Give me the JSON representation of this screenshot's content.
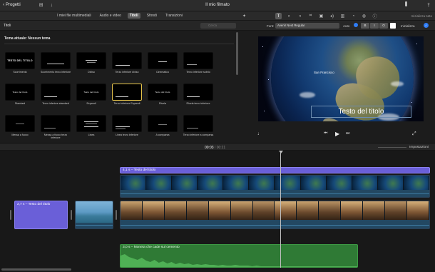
{
  "window": {
    "back_label": "Progetti",
    "title": "Il mio filmato"
  },
  "browser": {
    "tabs": [
      {
        "label": "I miei file multimediali",
        "active": false
      },
      {
        "label": "Audio e video",
        "active": false
      },
      {
        "label": "Titoli",
        "active": true
      },
      {
        "label": "Sfondi",
        "active": false
      },
      {
        "label": "Transizioni",
        "active": false
      }
    ],
    "section_title": "Titoli",
    "search_placeholder": "Cerca",
    "theme_label": "Tema attuale: Nessun tema",
    "titles": [
      {
        "label": "Scorrimento",
        "thumb": ""
      },
      {
        "label": "Scorrimento terzo inferiore",
        "thumb": ""
      },
      {
        "label": "Diviso",
        "thumb": ""
      },
      {
        "label": "Terzo inferiore diviso",
        "thumb": ""
      },
      {
        "label": "Cinematico",
        "thumb": ""
      },
      {
        "label": "Terzo inferiore sobrio",
        "thumb": ""
      },
      {
        "label": "Standard",
        "thumb": "Testo del titolo"
      },
      {
        "label": "Terzo inferiore standard",
        "thumb": ""
      },
      {
        "label": "Espandi",
        "thumb": "Testo del titolo"
      },
      {
        "label": "Terzo inferiore Espandi",
        "thumb": ""
      },
      {
        "label": "Rivela",
        "thumb": "Testo del titolo"
      },
      {
        "label": "Rivela terzo inferiore",
        "thumb": ""
      },
      {
        "label": "Messa a fuoco",
        "thumb": ""
      },
      {
        "label": "Messa a fuoco terzo inferiore",
        "thumb": ""
      },
      {
        "label": "Linea",
        "thumb": ""
      },
      {
        "label": "Linea terzo inferiore",
        "thumb": ""
      },
      {
        "label": "A comparsa",
        "thumb": ""
      },
      {
        "label": "Terzo inferiore a comparsa",
        "thumb": ""
      }
    ],
    "first_thumb_text": "TESTO DEL TITOLO"
  },
  "viewer_tools": {
    "reset_all": "Inizializza tutto"
  },
  "font_row": {
    "font_label": "Font:",
    "font_value": "Avenir Next Regular",
    "auto_label": "Auto",
    "bold": "B",
    "italic": "I",
    "outline": "O",
    "reset": "Inizializza",
    "text_color": "#ffffff"
  },
  "viewer": {
    "map_label": "San Francisco",
    "title_text": "Testo del titolo"
  },
  "timebar": {
    "current": "00:03",
    "separator": "/",
    "total": "00:21",
    "settings": "Impostazioni"
  },
  "timeline": {
    "title_clip_label": "4,1 s – Testo del titolo",
    "lone_title_label": "2,7 s – Testo del titolo",
    "audio_label": "3,0 s – Moneta che cade sul cemento"
  },
  "colors": {
    "title_clip": "#6a5fd8",
    "audio_clip": "#2f7a35",
    "accent": "#2f7df6"
  }
}
